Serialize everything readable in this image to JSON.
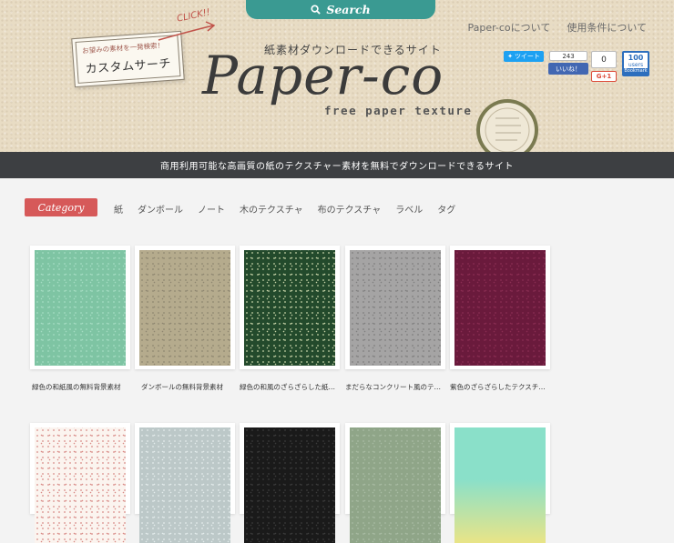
{
  "search": {
    "label": "Search"
  },
  "top_links": [
    "Paper-coについて",
    "使用条件について"
  ],
  "custom_search": {
    "small": "お望みの素材を一発検索！",
    "big": "カスタムサーチ",
    "click": "CLICK!!"
  },
  "site": {
    "subtitle": "紙素材ダウンロードできるサイト",
    "logo": "Paper-co",
    "tagline": "free paper texture"
  },
  "social": {
    "tweet": "ツイート",
    "fb_count": "243",
    "fb_like": "いいね！",
    "gplus_count": "0",
    "gplus": "G+1",
    "hatena_count": "100",
    "hatena_users": "users",
    "hatena_label": "Bookmark"
  },
  "banner": "商用利用可能な高画質の紙のテクスチャー素材を無料でダウンロードできるサイト",
  "category": {
    "label": "Category",
    "items": [
      "紙",
      "ダンボール",
      "ノート",
      "木のテクスチャ",
      "布のテクスチャ",
      "ラベル",
      "タグ"
    ]
  },
  "cards": [
    {
      "title": "緑色の和紙風の無料背景素材",
      "color": "#7ec4a3",
      "grain": "#a5dcc2"
    },
    {
      "title": "ダンボールの無料背景素材",
      "color": "#b5ab8d",
      "grain": "#8e8670"
    },
    {
      "title": "緑色の和風のざらざらした紙…",
      "color": "#234a2c",
      "grain": "#c8d4a8"
    },
    {
      "title": "まだらなコンクリート風のテ…",
      "color": "#a5a4a4",
      "grain": "#7f7f7f"
    },
    {
      "title": "紫色のざらざらしたテクスチ…",
      "color": "#6a1a3c",
      "grain": "#8a2d52"
    },
    {
      "title": "",
      "color": "#fbf4ef",
      "grain": "#d88a86"
    },
    {
      "title": "",
      "color": "#bcc8c8",
      "grain": "#e4ecec"
    },
    {
      "title": "",
      "color": "#1a1a1a",
      "grain": "#3b3b3b"
    },
    {
      "title": "",
      "color": "#8fa588",
      "grain": "#a9bca3"
    },
    {
      "title": "",
      "color": "#8ae0c9",
      "grain": "#e9e487"
    }
  ]
}
